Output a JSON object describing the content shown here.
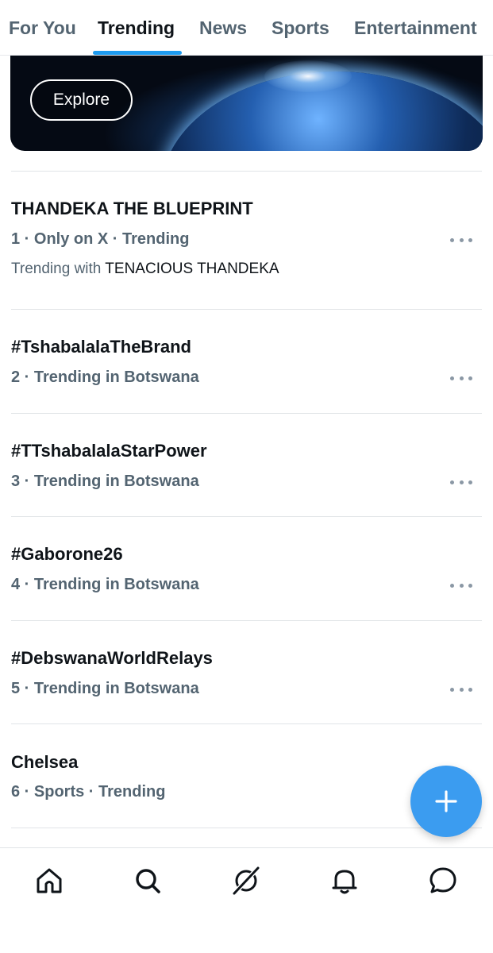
{
  "tabs": [
    {
      "label": "For You",
      "active": false
    },
    {
      "label": "Trending",
      "active": true
    },
    {
      "label": "News",
      "active": false
    },
    {
      "label": "Sports",
      "active": false
    },
    {
      "label": "Entertainment",
      "active": false
    }
  ],
  "banner": {
    "explore_label": "Explore"
  },
  "trends": [
    {
      "title": "THANDEKA THE BLUEPRINT",
      "meta": "1 · Only on X · Trending",
      "with_prefix": "Trending with",
      "with_name": "TENACIOUS THANDEKA"
    },
    {
      "title": "#TshabalalaTheBrand",
      "meta": "2 · Trending in Botswana"
    },
    {
      "title": "#TTshabalalaStarPower",
      "meta": "3 · Trending in Botswana"
    },
    {
      "title": "#Gaborone26",
      "meta": "4 · Trending in Botswana"
    },
    {
      "title": "#DebswanaWorldRelays",
      "meta": "5 · Trending in Botswana"
    },
    {
      "title": "Chelsea",
      "meta": "6 · Sports · Trending"
    }
  ],
  "fab": {
    "icon": "plus-icon"
  },
  "bottom_nav": [
    {
      "icon": "home-icon"
    },
    {
      "icon": "search-icon"
    },
    {
      "icon": "grok-icon"
    },
    {
      "icon": "bell-icon"
    },
    {
      "icon": "messages-icon"
    }
  ],
  "colors": {
    "accent": "#1d9bf0",
    "fab": "#3b9cf0",
    "text_primary": "#0f1419",
    "text_secondary": "#536471"
  }
}
